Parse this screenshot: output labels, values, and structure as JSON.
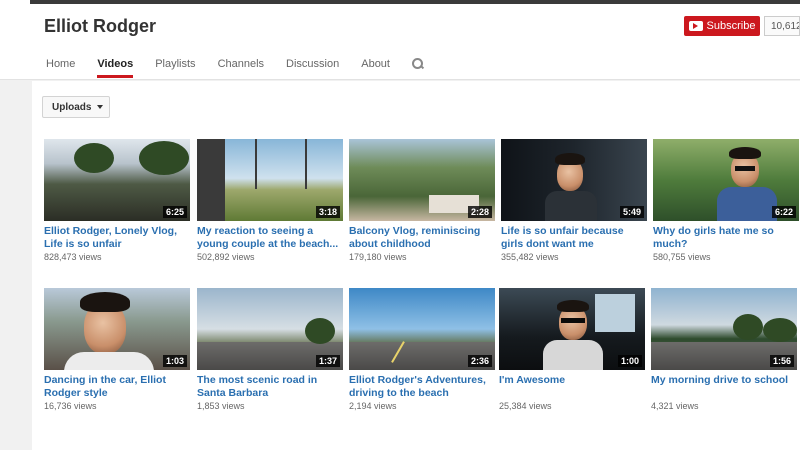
{
  "channel": {
    "name": "Elliot Rodger",
    "subscribe_label": "Subscribe",
    "subscriber_count": "10,612"
  },
  "tabs": [
    "Home",
    "Videos",
    "Playlists",
    "Channels",
    "Discussion",
    "About"
  ],
  "active_tab": "Videos",
  "filter": {
    "label": "Uploads"
  },
  "videos": [
    {
      "title": "Elliot Rodger, Lonely Vlog, Life is so unfair",
      "views": "828,473 views",
      "duration": "6:25"
    },
    {
      "title": "My reaction to seeing a young couple at the beach...",
      "views": "502,892 views",
      "duration": "3:18"
    },
    {
      "title": "Balcony Vlog, reminiscing about childhood",
      "views": "179,180 views",
      "duration": "2:28"
    },
    {
      "title": "Life is so unfair because girls dont want me",
      "views": "355,482 views",
      "duration": "5:49"
    },
    {
      "title": "Why do girls hate me so much?",
      "views": "580,755 views",
      "duration": "6:22"
    },
    {
      "title": "Dancing in the car, Elliot Rodger style",
      "views": "16,736 views",
      "duration": "1:03"
    },
    {
      "title": "The most scenic road in Santa Barbara",
      "views": "1,853 views",
      "duration": "1:37"
    },
    {
      "title": "Elliot Rodger's Adventures, driving to the beach",
      "views": "2,194 views",
      "duration": "2:36"
    },
    {
      "title": "I'm Awesome",
      "views": "25,384 views",
      "duration": "1:00"
    },
    {
      "title": "My morning drive to school",
      "views": "4,321 views",
      "duration": "1:56"
    }
  ],
  "colors": {
    "brand_red": "#cc181e",
    "link_blue": "#2a6fb0"
  },
  "icons": {
    "tab_search": "search-icon",
    "subscribe": "youtube-play-icon",
    "filter": "caret-down-icon"
  }
}
